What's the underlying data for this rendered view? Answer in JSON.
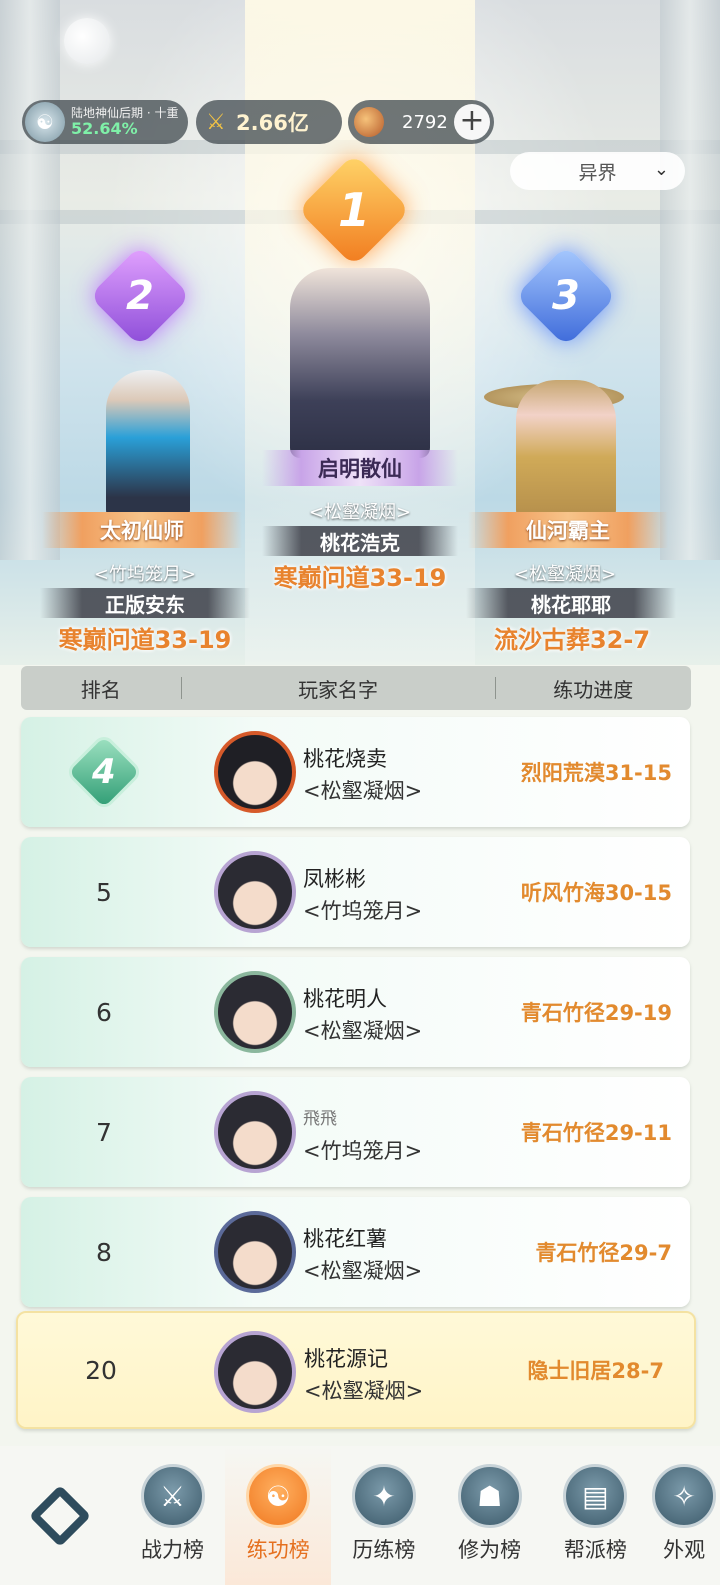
{
  "header": {
    "realm_name": "陆地神仙后期 · 十重",
    "realm_progress": "52.64%",
    "power": "2.66亿",
    "currency": "2792",
    "world_select": "异界"
  },
  "podium": [
    {
      "rank": "1",
      "title": "启明散仙",
      "guild": "<松壑凝烟>",
      "name": "桃花浩克",
      "progress": "寒巅问道33-19"
    },
    {
      "rank": "2",
      "title": "太初仙师",
      "guild": "<竹坞笼月>",
      "name": "正版安东",
      "progress": "寒巅问道33-19"
    },
    {
      "rank": "3",
      "title": "仙河霸主",
      "guild": "<松壑凝烟>",
      "name": "桃花耶耶",
      "progress": "流沙古葬32-7"
    }
  ],
  "table": {
    "headers": [
      "排名",
      "玩家名字",
      "练功进度"
    ],
    "rows": [
      {
        "rank": "4",
        "name": "桃花烧卖",
        "guild": "<松壑凝烟>",
        "progress": "烈阳荒漠31-15"
      },
      {
        "rank": "5",
        "name": "凤彬彬",
        "guild": "<竹坞笼月>",
        "progress": "听风竹海30-15"
      },
      {
        "rank": "6",
        "name": "桃花明人",
        "guild": "<松壑凝烟>",
        "progress": "青石竹径29-19"
      },
      {
        "rank": "7",
        "name": "飛飛",
        "guild": "<竹坞笼月>",
        "progress": "青石竹径29-11"
      },
      {
        "rank": "8",
        "name": "桃花红薯",
        "guild": "<松壑凝烟>",
        "progress": "青石竹径29-7"
      }
    ],
    "me": {
      "rank": "20",
      "name": "桃花源记",
      "guild": "<松壑凝烟>",
      "progress": "隐士旧居28-7"
    }
  },
  "nav": {
    "home_icon": "diamond-logo-icon",
    "items": [
      {
        "label": "战力榜",
        "icon": "swords-icon"
      },
      {
        "label": "练功榜",
        "icon": "yin-yang-icon"
      },
      {
        "label": "历练榜",
        "icon": "star-icon"
      },
      {
        "label": "修为榜",
        "icon": "hat-icon"
      },
      {
        "label": "帮派榜",
        "icon": "scroll-icon"
      },
      {
        "label": "外观",
        "icon": "wardrobe-icon"
      }
    ]
  },
  "colors": {
    "accent": "#e5701f",
    "progress_text": "#e28a2e",
    "realm_pct": "#7ff0a8"
  }
}
